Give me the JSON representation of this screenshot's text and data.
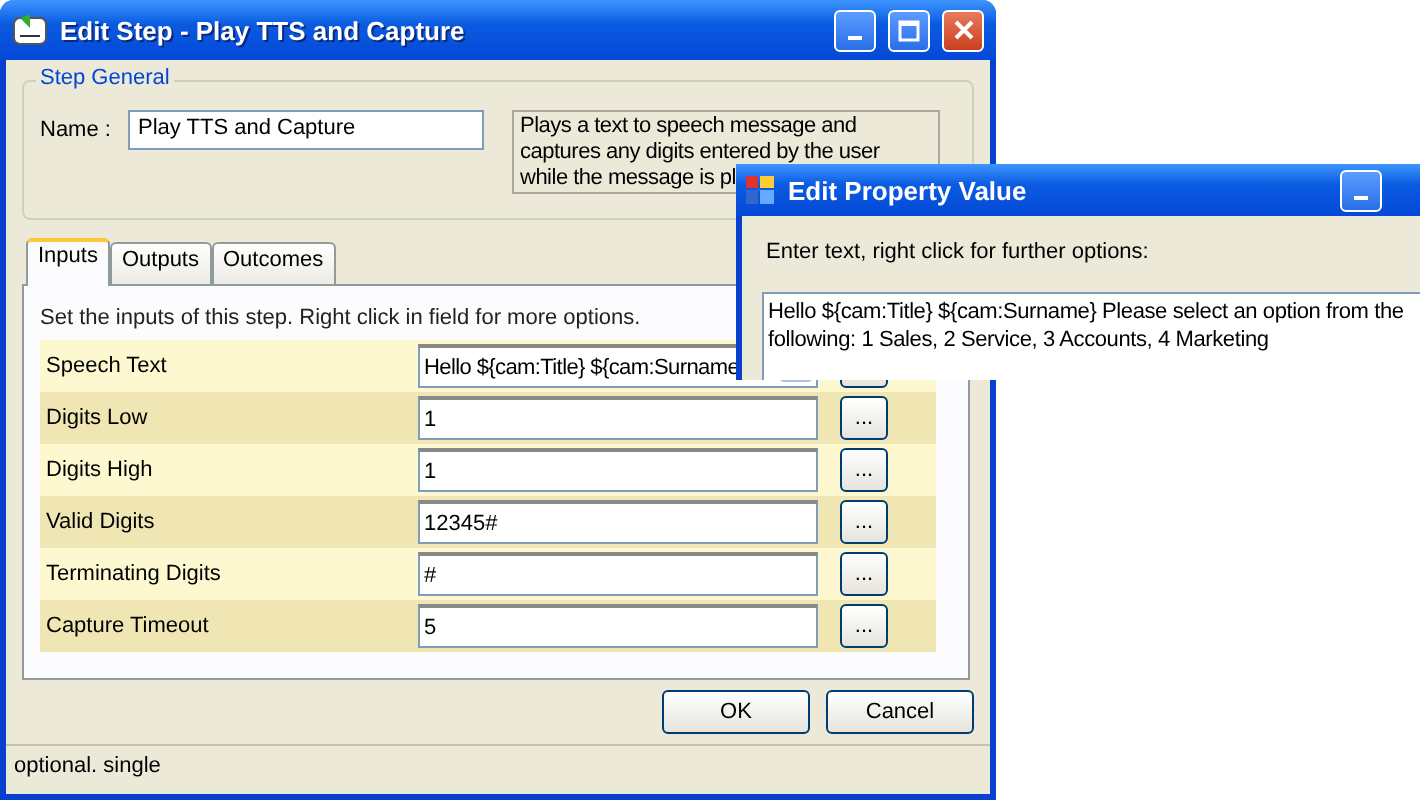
{
  "main_window": {
    "title": "Edit Step - Play TTS and Capture"
  },
  "step_general": {
    "title": "Step General",
    "name_label": "Name :",
    "name_value": "Play TTS and Capture",
    "description_lines": [
      "Plays a text to speech message and",
      "captures any digits entered by the user",
      "while the message is pl"
    ]
  },
  "tabs": [
    {
      "label": "Inputs",
      "selected": true
    },
    {
      "label": "Outputs",
      "selected": false
    },
    {
      "label": "Outcomes",
      "selected": false
    }
  ],
  "inputs_hint": "Set the inputs of this step.  Right click in field for more options.",
  "inputs": [
    {
      "label": "Speech Text",
      "value": "Hello ${cam:Title} ${cam:Surname",
      "kind": "dropdown"
    },
    {
      "label": "Digits Low",
      "value": "1",
      "kind": "text",
      "button": "..."
    },
    {
      "label": "Digits High",
      "value": "1",
      "kind": "text",
      "button": "..."
    },
    {
      "label": "Valid Digits",
      "value": "12345#",
      "kind": "text",
      "button": "..."
    },
    {
      "label": "Terminating Digits",
      "value": "#",
      "kind": "text",
      "button": "..."
    },
    {
      "label": "Capture Timeout",
      "value": "5",
      "kind": "text",
      "button": "..."
    }
  ],
  "buttons": [
    "OK",
    "Cancel"
  ],
  "status_bar": "optional. single",
  "popup": {
    "title": "Edit Property Value",
    "prompt": "Enter text, right click for further options:",
    "value": "Hello ${cam:Title} ${cam:Surname} Please select an option from the following:  1  Sales, 2  Service, 3  Accounts, 4  Marketing"
  }
}
